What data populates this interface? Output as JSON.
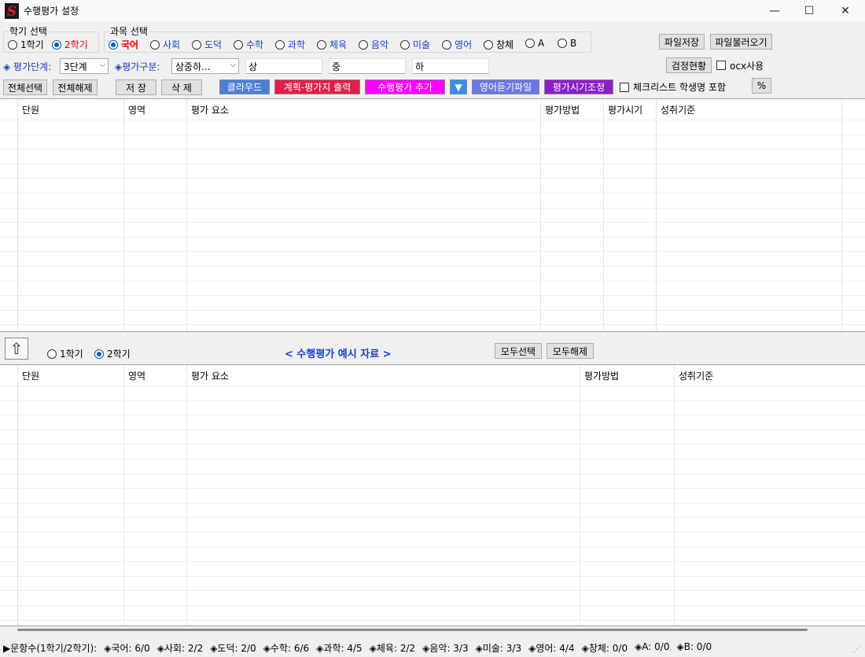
{
  "window": {
    "title": "수행평가 설정",
    "min": "—",
    "max": "☐",
    "close": "✕"
  },
  "semester": {
    "legend": "학기 선택",
    "options": [
      "1학기",
      "2학기"
    ],
    "selected": "2학기"
  },
  "subject": {
    "legend": "과목 선택",
    "options": [
      "국어",
      "사회",
      "도덕",
      "수학",
      "과학",
      "체육",
      "음악",
      "미술",
      "영어",
      "창체",
      "A",
      "B"
    ],
    "selected": "국어"
  },
  "file": {
    "save": "파일저장",
    "load": "파일불러오기"
  },
  "eval": {
    "stage_label": "◈ 평가단계:",
    "stage_value": "3단계",
    "type_label": "◈평가구분:",
    "type_value": "상중하...",
    "high": "상",
    "mid": "중",
    "low": "하",
    "check_status": "검정현황",
    "ocx_label": "ocx사용"
  },
  "toolbar": {
    "select_all": "전체선택",
    "deselect_all": "전체해제",
    "save": "저 장",
    "delete": "삭 제",
    "cloud": "클라우드",
    "plan_print": "계획-평가지 출력",
    "add_eval": "수행평가 추가",
    "dropdown": "▼",
    "english_listening": "영어듣기파일",
    "time_adjust": "평가시기조정",
    "checklist_label": "체크리스트 학생명 포함",
    "percent": "%"
  },
  "upper_grid": {
    "headers": [
      "단원",
      "영역",
      "평가 요소",
      "평가방법",
      "평가시기",
      "성취기준"
    ]
  },
  "middle": {
    "up_icon": "⇧",
    "semester_options": [
      "1학기",
      "2학기"
    ],
    "semester_selected": "2학기",
    "title": "< 수행평가 예시 자료 >",
    "select_all": "모두선택",
    "deselect_all": "모두해제"
  },
  "lower_grid": {
    "headers": [
      "단원",
      "영역",
      "평가 요소",
      "평가방법",
      "성취기준"
    ]
  },
  "status": {
    "prefix": "▶문항수(1학기/2학기):",
    "items": [
      "◈국어: 6/0",
      "◈사회: 2/2",
      "◈도덕: 2/0",
      "◈수학: 6/6",
      "◈과학: 4/5",
      "◈체육: 2/2",
      "◈음악: 3/3",
      "◈미술: 3/3",
      "◈영어: 4/4",
      "◈창체: 0/0",
      "◈A: 0/0",
      "◈B: 0/0"
    ]
  },
  "colors": {
    "accent_blue": "#1a3fc2",
    "subject_red": "#e00000",
    "cloud_btn": "#4a7fd8",
    "plan_btn": "#e0204a",
    "add_btn": "#ff00ff",
    "dropdown_btn": "#3a8ee6",
    "english_btn": "#6a78e6",
    "time_btn": "#8a1fc7"
  }
}
